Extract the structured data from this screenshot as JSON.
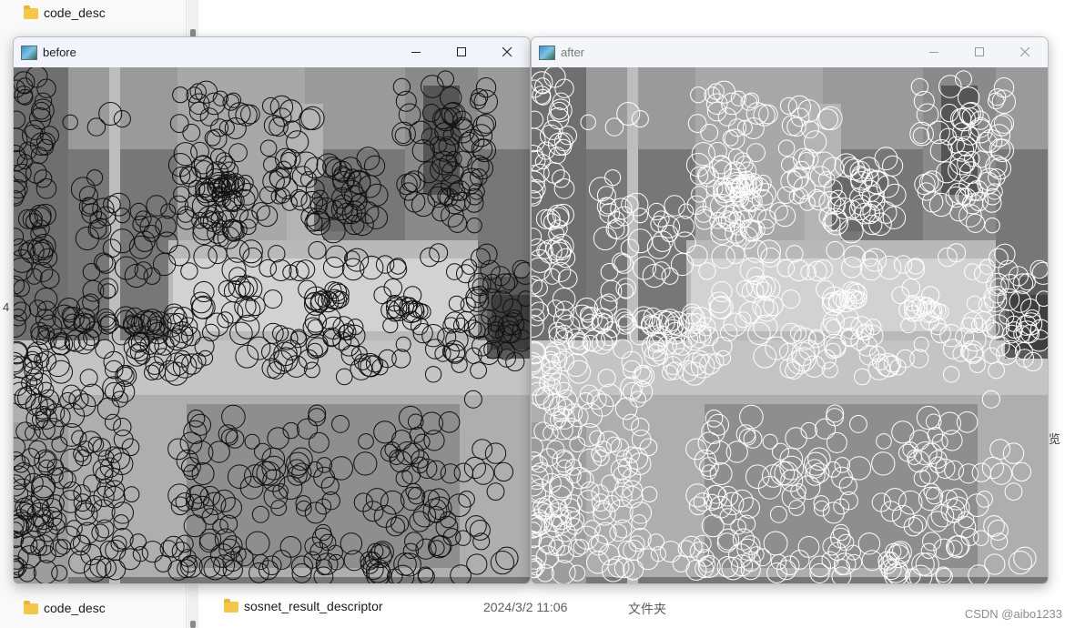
{
  "explorer": {
    "nav_top_folder": "code_desc",
    "nav_bottom_folder": "code_desc",
    "row": {
      "name": "sosnet_result_descriptor",
      "date": "2024/3/2 11:06",
      "type": "文件夹"
    },
    "side_number": "4",
    "side_text": "览"
  },
  "windows": [
    {
      "title": "before",
      "ring_color": "#111111",
      "active": true
    },
    {
      "title": "after",
      "ring_color": "#ffffff",
      "active": false
    }
  ],
  "watermark": "CSDN @aibo1233"
}
